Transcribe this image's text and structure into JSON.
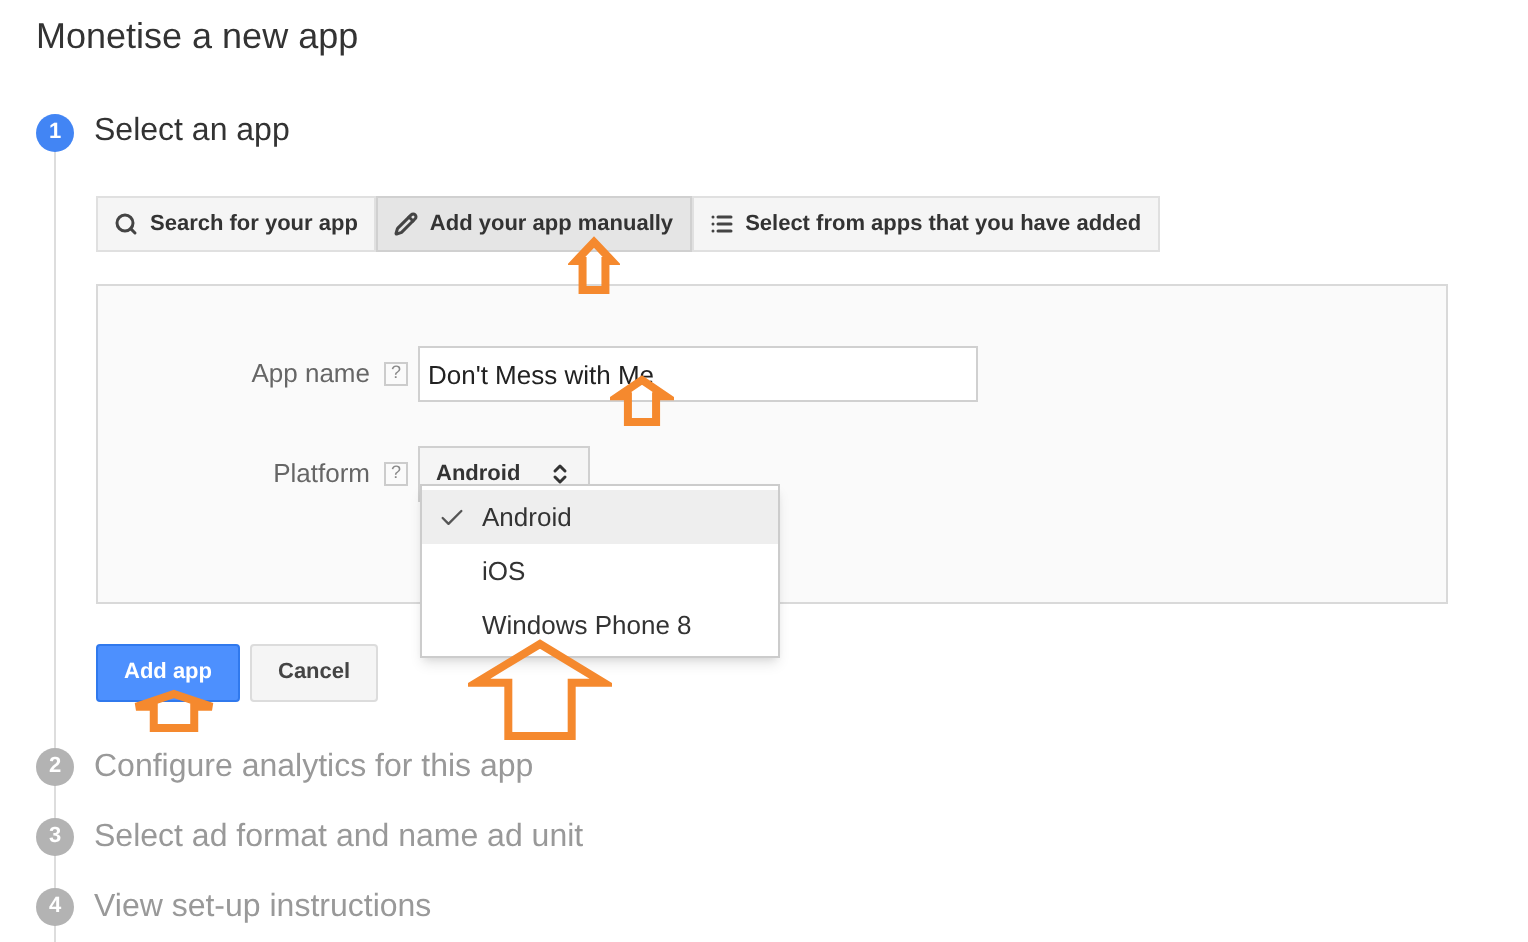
{
  "title": "Monetise a new app",
  "steps": [
    {
      "number": "1",
      "label": "Select an app",
      "selected": true
    },
    {
      "number": "2",
      "label": "Configure analytics for this app",
      "selected": false
    },
    {
      "number": "3",
      "label": "Select ad format and name ad unit",
      "selected": false
    },
    {
      "number": "4",
      "label": "View set-up instructions",
      "selected": false
    }
  ],
  "tabs": [
    {
      "label": "Search for your app",
      "selected": false
    },
    {
      "label": "Add your app manually",
      "selected": true
    },
    {
      "label": "Select from apps that you have added",
      "selected": false
    }
  ],
  "form": {
    "app_name": {
      "label": "App name",
      "help": "?",
      "value": "Don't Mess with Me"
    },
    "platform": {
      "label": "Platform",
      "help": "?",
      "value": "Android",
      "options": [
        {
          "label": "Android",
          "selected": true
        },
        {
          "label": "iOS",
          "selected": false
        },
        {
          "label": "Windows Phone 8",
          "selected": false
        }
      ]
    }
  },
  "buttons": [
    {
      "label": "Add app",
      "kind": "primary"
    },
    {
      "label": "Cancel",
      "kind": "secondary"
    }
  ]
}
